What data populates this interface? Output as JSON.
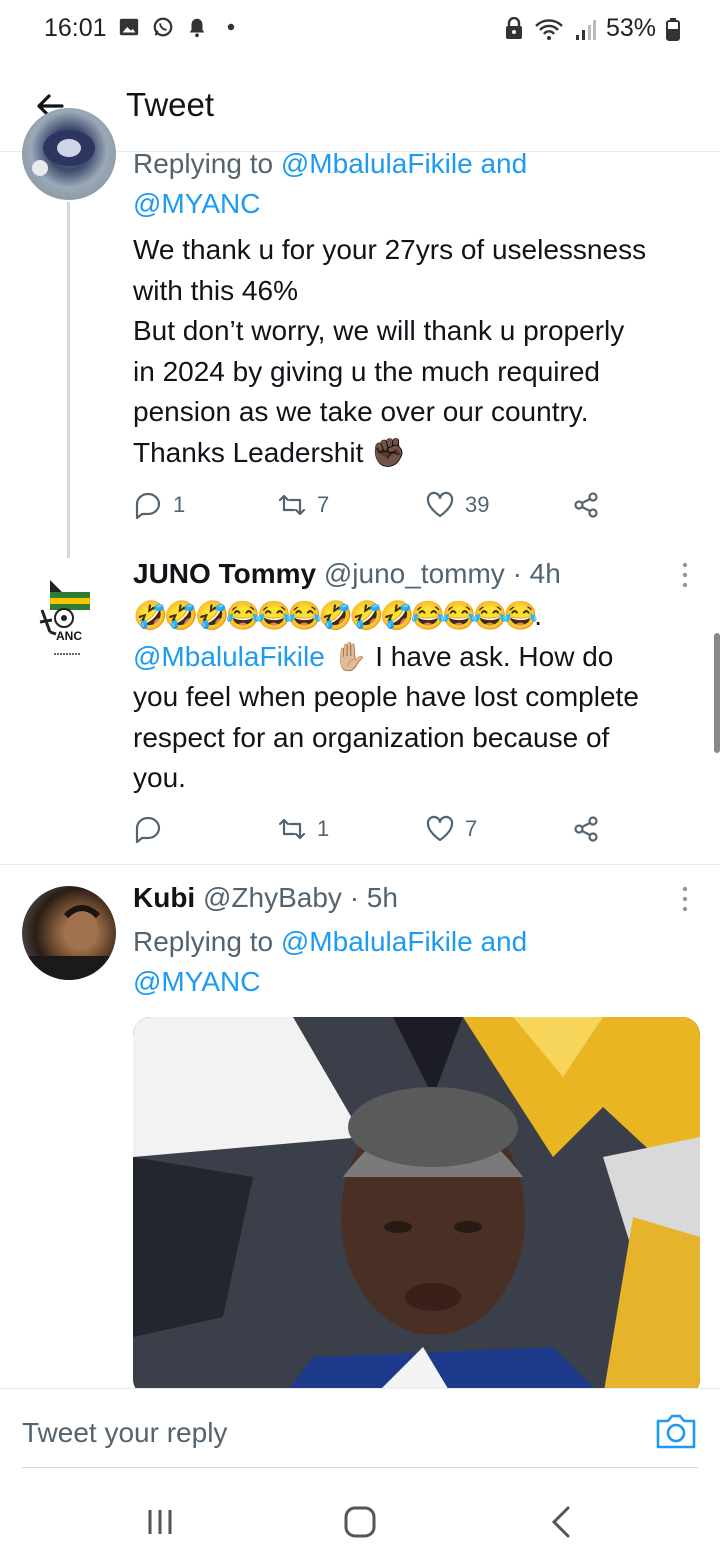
{
  "status_bar": {
    "time": "16:01",
    "battery": "53%",
    "icons": [
      "gallery-icon",
      "whatsapp-icon",
      "notification-bell-icon",
      "dot-icon",
      "lock-icon",
      "wifi-icon",
      "signal-icon",
      "battery-icon"
    ]
  },
  "header": {
    "title": "Tweet",
    "back_icon": "back-arrow-icon"
  },
  "tweet1": {
    "reply_prefix": "Replying to ",
    "reply_handles": "@MbalulaFikile and",
    "reply_handles2": "@MYANC",
    "text_lines": [
      "We thank u for your 27yrs of uselessness",
      "with this 46%",
      "But don’t worry, we will thank u properly",
      "in 2024 by giving u the much required",
      "pension as we take over our country.",
      "Thanks Leadershit ✊🏿"
    ],
    "replies": "1",
    "retweets": "7",
    "likes": "39"
  },
  "tweet2": {
    "name": "JUNO Tommy",
    "handle_time": "@juno_tommy · 4h",
    "emoji_line": "🤣🤣🤣😂😂😂🤣🤣🤣😂😂😂😂.",
    "mention": "@MbalulaFikile",
    "text_after_mention": " ✋🏼 I have ask.  How do",
    "text_lines": [
      "you feel when people have lost complete",
      "respect for an organization because of",
      "you."
    ],
    "replies": "",
    "retweets": "1",
    "likes": "7",
    "avatar_label": "ANC"
  },
  "tweet3": {
    "name": "Kubi",
    "handle_time": "@ZhyBaby · 5h",
    "reply_prefix": "Replying to ",
    "reply_handles": "@MbalulaFikile and",
    "reply_handles2": "@MYANC"
  },
  "reply_bar": {
    "placeholder": "Tweet your reply",
    "camera_icon": "camera-icon"
  },
  "nav_bar": {
    "buttons": [
      "recent-apps-icon",
      "home-icon",
      "back-icon"
    ]
  },
  "colors": {
    "link": "#1d9bf0",
    "secondary_text": "#536471",
    "primary_text": "#0f1419"
  }
}
